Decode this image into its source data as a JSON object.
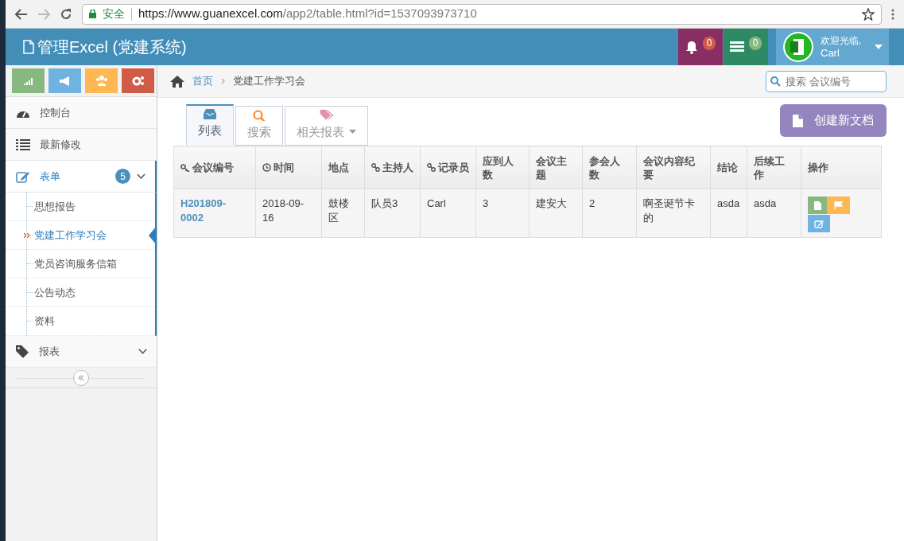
{
  "browser": {
    "secure_label": "安全",
    "url_host": "https://www.guanexcel.com",
    "url_path": "/app2/table.html?id=1537093973710"
  },
  "header": {
    "title": "管理Excel (党建系统)",
    "notification_count": "0",
    "message_count": "0",
    "welcome": "欢迎光临,",
    "user": "Carl"
  },
  "shortcuts": [
    {
      "color": "#87b87f"
    },
    {
      "color": "#6fb3e0"
    },
    {
      "color": "#ffb752"
    },
    {
      "color": "#d15b47"
    }
  ],
  "breadcrumb": {
    "home": "首页",
    "current": "党建工作学习会"
  },
  "search": {
    "placeholder": "搜索 会议编号"
  },
  "sidebar": {
    "items": [
      {
        "label": "控制台"
      },
      {
        "label": "最新修改"
      },
      {
        "label": "表单",
        "badge": "5",
        "expanded": true,
        "children": [
          {
            "label": "思想报告",
            "selected": false
          },
          {
            "label": "党建工作学习会",
            "selected": true
          },
          {
            "label": "党员咨询服务信箱",
            "selected": false
          },
          {
            "label": "公告动态",
            "selected": false
          },
          {
            "label": "资料",
            "selected": false
          }
        ]
      },
      {
        "label": "报表",
        "expanded": false
      }
    ]
  },
  "tabs": [
    {
      "label": "列表",
      "selected": true
    },
    {
      "label": "搜索",
      "selected": false
    },
    {
      "label": "相关报表",
      "selected": false
    }
  ],
  "create_button": "创建新文档",
  "table": {
    "columns": [
      "会议编号",
      "时间",
      "地点",
      "主持人",
      "记录员",
      "应到人数",
      "会议主题",
      "参会人数",
      "会议内容纪要",
      "结论",
      "后续工作",
      "操作"
    ],
    "rows": [
      [
        "H201809-0002",
        "2018-09-16",
        "鼓楼区",
        "队员3",
        "Carl",
        "3",
        "建安大",
        "2",
        "啊圣诞节卡的",
        "asda",
        "asda"
      ]
    ]
  }
}
